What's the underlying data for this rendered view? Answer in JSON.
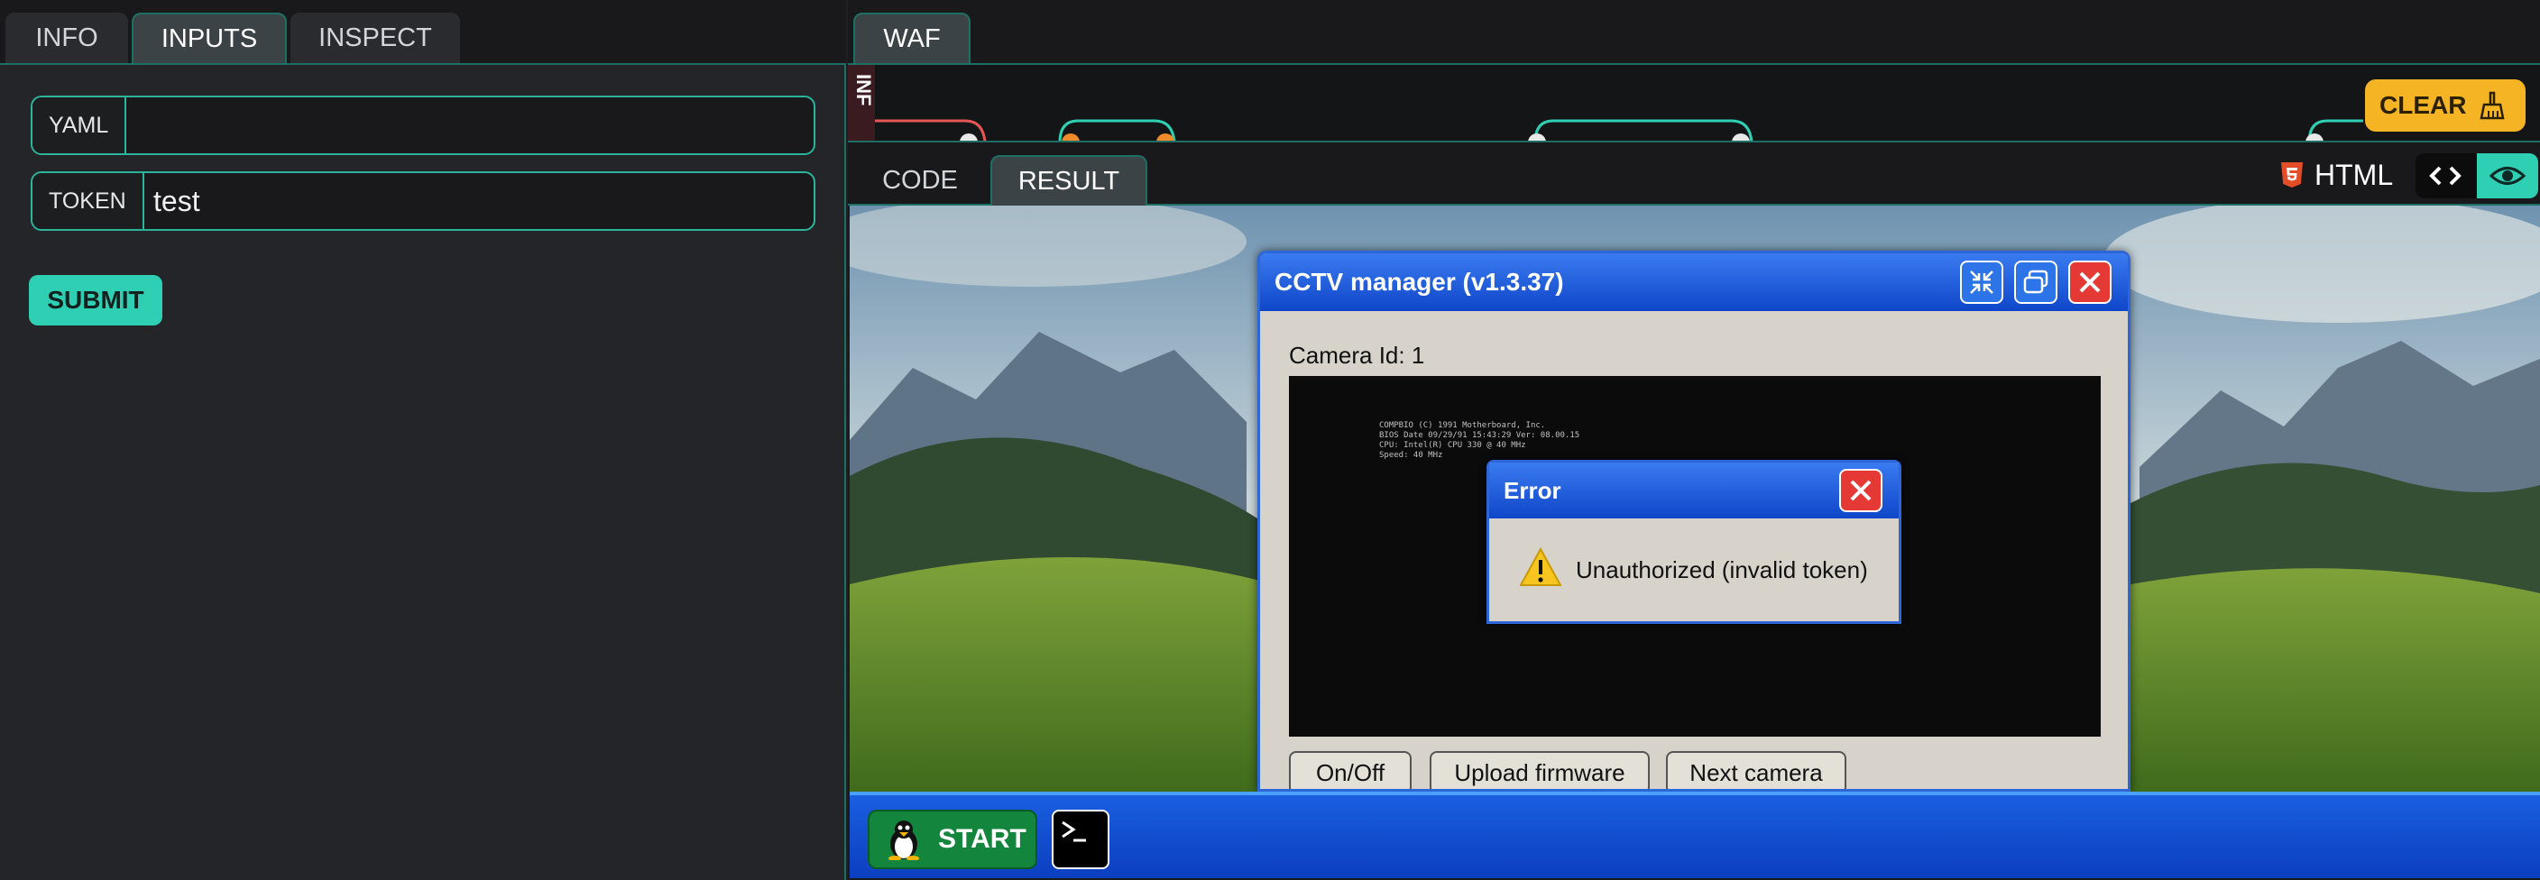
{
  "left_panel": {
    "tabs": [
      {
        "label": "INFO"
      },
      {
        "label": "INPUTS"
      },
      {
        "label": "INSPECT"
      }
    ],
    "fields": {
      "yaml": {
        "label": "YAML",
        "value": ""
      },
      "token": {
        "label": "TOKEN",
        "value": "test"
      }
    },
    "submit_label": "SUBMIT"
  },
  "right_panel": {
    "top_tab": "WAF",
    "graph_side_label": "INF",
    "clear_label": "CLEAR",
    "code_tabs": [
      {
        "label": "CODE"
      },
      {
        "label": "RESULT"
      }
    ],
    "format_label": "HTML"
  },
  "cctv_window": {
    "title": "CCTV manager (v1.3.37)",
    "camera_label": "Camera Id: 1",
    "bios_lines": [
      "COMPBIO (C) 1991 Motherboard, Inc.",
      "BIOS Date 09/29/91 15:43:29 Ver: 08.00.15",
      "CPU: Intel(R) CPU 330 @ 40 MHz",
      "Speed: 40 MHz"
    ],
    "buttons": {
      "onoff": "On/Off",
      "upload": "Upload firmware",
      "next": "Next camera"
    }
  },
  "error_dialog": {
    "title": "Error",
    "message": "Unauthorized (invalid token)"
  },
  "taskbar": {
    "start_label": "START"
  },
  "colors": {
    "accent_teal": "#2ecfb2",
    "window_blue": "#1f5ae0",
    "clear_yellow": "#f5b424",
    "close_red": "#e53935"
  }
}
